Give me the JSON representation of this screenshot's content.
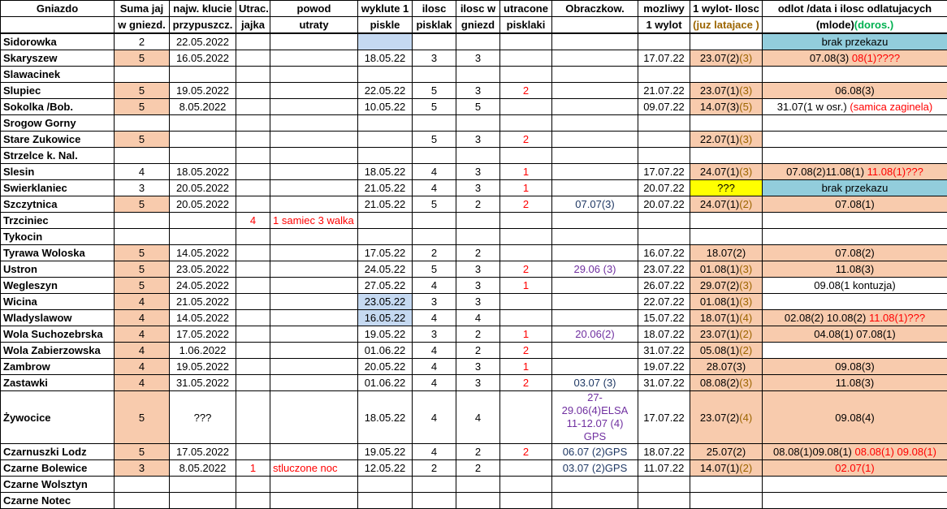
{
  "headers": {
    "row1": [
      "Gniazdo",
      "Suma jaj",
      "najw. klucie",
      "Utrac.",
      "powod",
      "wyklute 1",
      "ilosc",
      "ilosc w",
      "utracone",
      "Obraczkow.",
      "mozliwy",
      "1 wylot- Ilosc",
      "odlot /data i ilosc odlatujacych"
    ],
    "row2": [
      "",
      "w gniezd.",
      "przypuszcz.",
      "jajka",
      "utraty",
      "piskle",
      "pisklak",
      "gniezd",
      "pisklaki",
      "",
      "1 wylot",
      "(juz latajace )",
      "(mlode)",
      "(doros.)"
    ]
  },
  "rows": [
    {
      "name": "Sidorowka",
      "suma": "2",
      "klucie": "22.05.2022",
      "utrac": "",
      "powod": "",
      "wyklute": "",
      "ilosc": "",
      "gniezd": "",
      "utracone": "",
      "obr": "",
      "mozliwy": "",
      "wylot_a": "",
      "wylot_b": "",
      "odlot": [
        {
          "t": "brak przekazu",
          "c": ""
        }
      ]
    },
    {
      "name": "Skaryszew",
      "suma": "5",
      "klucie": "16.05.2022",
      "utrac": "",
      "powod": "",
      "wyklute": "18.05.22",
      "ilosc": "3",
      "gniezd": "3",
      "utracone": "",
      "obr": "",
      "mozliwy": "17.07.22",
      "wylot_a": "23.07(2)",
      "wylot_b": "(3)",
      "odlot": [
        {
          "t": "07.08(3)  ",
          "c": ""
        },
        {
          "t": "08(1)????",
          "c": "red"
        }
      ]
    },
    {
      "name": "Slawacinek",
      "suma": "",
      "klucie": "",
      "utrac": "",
      "powod": "",
      "wyklute": "",
      "ilosc": "",
      "gniezd": "",
      "utracone": "",
      "obr": "",
      "mozliwy": "",
      "wylot_a": "",
      "wylot_b": "",
      "odlot": []
    },
    {
      "name": "Slupiec",
      "suma": "5",
      "klucie": "19.05.2022",
      "utrac": "",
      "powod": "",
      "wyklute": "22.05.22",
      "ilosc": "5",
      "gniezd": "3",
      "utracone": "2",
      "obr": "",
      "mozliwy": "21.07.22",
      "wylot_a": "23.07(1)",
      "wylot_b": "(3)",
      "odlot": [
        {
          "t": "06.08(3)",
          "c": ""
        }
      ]
    },
    {
      "name": "Sokolka /Bob.",
      "suma": "5",
      "klucie": "8.05.2022",
      "utrac": "",
      "powod": "",
      "wyklute": "10.05.22",
      "ilosc": "5",
      "gniezd": "5",
      "utracone": "",
      "obr": "",
      "mozliwy": "09.07.22",
      "wylot_a": "14.07(3)",
      "wylot_b": "(5)",
      "odlot": [
        {
          "t": "31.07(1 w osr.) ",
          "c": ""
        },
        {
          "t": "(samica zaginela)",
          "c": "red"
        }
      ]
    },
    {
      "name": "Srogow Gorny",
      "suma": "",
      "klucie": "",
      "utrac": "",
      "powod": "",
      "wyklute": "",
      "ilosc": "",
      "gniezd": "",
      "utracone": "",
      "obr": "",
      "mozliwy": "",
      "wylot_a": "",
      "wylot_b": "",
      "odlot": []
    },
    {
      "name": "Stare Zukowice",
      "suma": "5",
      "klucie": "",
      "utrac": "",
      "powod": "",
      "wyklute": "",
      "ilosc": "5",
      "gniezd": "3",
      "utracone": "2",
      "obr": "",
      "mozliwy": "",
      "wylot_a": "22.07(1)",
      "wylot_b": "(3)",
      "odlot": []
    },
    {
      "name": "Strzelce k. Nal.",
      "suma": "",
      "klucie": "",
      "utrac": "",
      "powod": "",
      "wyklute": "",
      "ilosc": "",
      "gniezd": "",
      "utracone": "",
      "obr": "",
      "mozliwy": "",
      "wylot_a": "",
      "wylot_b": "",
      "odlot": []
    },
    {
      "name": "Slesin",
      "suma": "4",
      "klucie": "18.05.2022",
      "utrac": "",
      "powod": "",
      "wyklute": "18.05.22",
      "ilosc": "4",
      "gniezd": "3",
      "utracone": "1",
      "obr": "",
      "mozliwy": "17.07.22",
      "wylot_a": "24.07(1)",
      "wylot_b": "(3)",
      "odlot": [
        {
          "t": "07.08(2)11.08(1)  ",
          "c": ""
        },
        {
          "t": "11.08(1)???",
          "c": "red"
        }
      ]
    },
    {
      "name": "Swierklaniec",
      "suma": "3",
      "klucie": "20.05.2022",
      "utrac": "",
      "powod": "",
      "wyklute": "21.05.22",
      "ilosc": "4",
      "gniezd": "3",
      "utracone": "1",
      "obr": "",
      "mozliwy": "20.07.22",
      "wylot_a": "???",
      "wylot_b": "",
      "odlot": [
        {
          "t": "brak przekazu",
          "c": ""
        }
      ]
    },
    {
      "name": "Szczytnica",
      "suma": "5",
      "klucie": "20.05.2022",
      "utrac": "",
      "powod": "",
      "wyklute": "21.05.22",
      "ilosc": "5",
      "gniezd": "2",
      "utracone": "2",
      "obr": "07.07(3)",
      "mozliwy": "20.07.22",
      "wylot_a": "24.07(1)",
      "wylot_b": "(2)",
      "odlot": [
        {
          "t": "07.08(1)",
          "c": ""
        }
      ]
    },
    {
      "name": "Trzciniec",
      "suma": "",
      "klucie": "",
      "utrac": "4",
      "powod": "1 samiec 3 walka",
      "wyklute": "",
      "ilosc": "",
      "gniezd": "",
      "utracone": "",
      "obr": "",
      "mozliwy": "",
      "wylot_a": "",
      "wylot_b": "",
      "odlot": []
    },
    {
      "name": "Tykocin",
      "suma": "",
      "klucie": "",
      "utrac": "",
      "powod": "",
      "wyklute": "",
      "ilosc": "",
      "gniezd": "",
      "utracone": "",
      "obr": "",
      "mozliwy": "",
      "wylot_a": "",
      "wylot_b": "",
      "odlot": []
    },
    {
      "name": "Tyrawa Woloska",
      "suma": "5",
      "klucie": "14.05.2022",
      "utrac": "",
      "powod": "",
      "wyklute": "17.05.22",
      "ilosc": "2",
      "gniezd": "2",
      "utracone": "",
      "obr": "",
      "mozliwy": "16.07.22",
      "wylot_a": "18.07(2)",
      "wylot_b": "",
      "odlot": [
        {
          "t": "07.08(2)",
          "c": ""
        }
      ]
    },
    {
      "name": "Ustron",
      "suma": "5",
      "klucie": "23.05.2022",
      "utrac": "",
      "powod": "",
      "wyklute": "24.05.22",
      "ilosc": "5",
      "gniezd": "3",
      "utracone": "2",
      "obr": "29.06 (3)",
      "mozliwy": "23.07.22",
      "wylot_a": "01.08(1)",
      "wylot_b": "(3)",
      "odlot": [
        {
          "t": "11.08(3)",
          "c": ""
        }
      ]
    },
    {
      "name": "Wegleszyn",
      "suma": "5",
      "klucie": "24.05.2022",
      "utrac": "",
      "powod": "",
      "wyklute": "27.05.22",
      "ilosc": "4",
      "gniezd": "3",
      "utracone": "1",
      "obr": "",
      "mozliwy": "26.07.22",
      "wylot_a": "29.07(2)",
      "wylot_b": "(3)",
      "odlot": [
        {
          "t": "09.08(1 kontuzja)",
          "c": ""
        }
      ]
    },
    {
      "name": "Wicina",
      "suma": "4",
      "klucie": "21.05.2022",
      "utrac": "",
      "powod": "",
      "wyklute": "23.05.22",
      "ilosc": "3",
      "gniezd": "3",
      "utracone": "",
      "obr": "",
      "mozliwy": "22.07.22",
      "wylot_a": "01.08(1)",
      "wylot_b": "(3)",
      "odlot": []
    },
    {
      "name": "Wladyslawow",
      "suma": "4",
      "klucie": "14.05.2022",
      "utrac": "",
      "powod": "",
      "wyklute": "16.05.22",
      "ilosc": "4",
      "gniezd": "4",
      "utracone": "",
      "obr": "",
      "mozliwy": "15.07.22",
      "wylot_a": "18.07(1)",
      "wylot_b": "(4)",
      "odlot": [
        {
          "t": "02.08(2) 10.08(2) ",
          "c": ""
        },
        {
          "t": "11.08(1)???",
          "c": "red"
        }
      ]
    },
    {
      "name": "Wola Suchozebrska",
      "suma": "4",
      "klucie": "17.05.2022",
      "utrac": "",
      "powod": "",
      "wyklute": "19.05.22",
      "ilosc": "3",
      "gniezd": "2",
      "utracone": "1",
      "obr": "20.06(2)",
      "mozliwy": "18.07.22",
      "wylot_a": "23.07(1)",
      "wylot_b": "(2)",
      "odlot": [
        {
          "t": "04.08(1) 07.08(1)",
          "c": ""
        }
      ]
    },
    {
      "name": "Wola Zabierzowska",
      "suma": "4",
      "klucie": "1.06.2022",
      "utrac": "",
      "powod": "",
      "wyklute": "01.06.22",
      "ilosc": "4",
      "gniezd": "2",
      "utracone": "2",
      "obr": "",
      "mozliwy": "31.07.22",
      "wylot_a": "05.08(1)",
      "wylot_b": "(2)",
      "odlot": []
    },
    {
      "name": "Zambrow",
      "suma": "4",
      "klucie": "19.05.2022",
      "utrac": "",
      "powod": "",
      "wyklute": "20.05.22",
      "ilosc": "4",
      "gniezd": "3",
      "utracone": "1",
      "obr": "",
      "mozliwy": "19.07.22",
      "wylot_a": "28.07(3)",
      "wylot_b": "",
      "odlot": [
        {
          "t": "09.08(3)",
          "c": ""
        }
      ]
    },
    {
      "name": "Zastawki",
      "suma": "4",
      "klucie": "31.05.2022",
      "utrac": "",
      "powod": "",
      "wyklute": "01.06.22",
      "ilosc": "4",
      "gniezd": "3",
      "utracone": "2",
      "obr": "03.07 (3)",
      "mozliwy": "31.07.22",
      "wylot_a": "08.08(2)",
      "wylot_b": "(3)",
      "odlot": [
        {
          "t": "11.08(3)",
          "c": ""
        }
      ]
    },
    {
      "name": "Żywocice",
      "suma": "5",
      "klucie": "???",
      "utrac": "",
      "powod": "",
      "wyklute": "18.05.22",
      "ilosc": "4",
      "gniezd": "4",
      "utracone": "",
      "obr": "27-29.06(4)ELSA",
      "obr2": "11-12.07 (4) GPS",
      "mozliwy": "17.07.22",
      "wylot_a": "23.07(2)",
      "wylot_b": "(4)",
      "odlot": [
        {
          "t": "09.08(4)",
          "c": ""
        }
      ]
    },
    {
      "name": "Czarnuszki Lodz",
      "suma": "5",
      "klucie": "17.05.2022",
      "utrac": "",
      "powod": "",
      "wyklute": "19.05.22",
      "ilosc": "4",
      "gniezd": "2",
      "utracone": "2",
      "obr": "06.07 (2)GPS",
      "mozliwy": "18.07.22",
      "wylot_a": "25.07(2)",
      "wylot_b": "",
      "odlot": [
        {
          "t": "08.08(1)09.08(1)  ",
          "c": ""
        },
        {
          "t": "08.08(1) 09.08(1)",
          "c": "red"
        }
      ]
    },
    {
      "name": "Czarne Bolewice",
      "suma": "3",
      "klucie": "8.05.2022",
      "utrac": "1",
      "powod": "stluczone noc",
      "wyklute": "12.05.22",
      "ilosc": "2",
      "gniezd": "2",
      "utracone": "",
      "obr": "03.07 (2)GPS",
      "mozliwy": "11.07.22",
      "wylot_a": "14.07(1)",
      "wylot_b": "(2)",
      "odlot": [
        {
          "t": "02.07(1)",
          "c": "red"
        }
      ]
    },
    {
      "name": "Czarne Wolsztyn",
      "suma": "",
      "klucie": "",
      "utrac": "",
      "powod": "",
      "wyklute": "",
      "ilosc": "",
      "gniezd": "",
      "utracone": "",
      "obr": "",
      "mozliwy": "",
      "wylot_a": "",
      "wylot_b": "",
      "odlot": []
    },
    {
      "name": "Czarne Notec",
      "suma": "",
      "klucie": "",
      "utrac": "",
      "powod": "",
      "wyklute": "",
      "ilosc": "",
      "gniezd": "",
      "utracone": "",
      "obr": "",
      "mozliwy": "",
      "wylot_a": "",
      "wylot_b": "",
      "odlot": []
    }
  ]
}
